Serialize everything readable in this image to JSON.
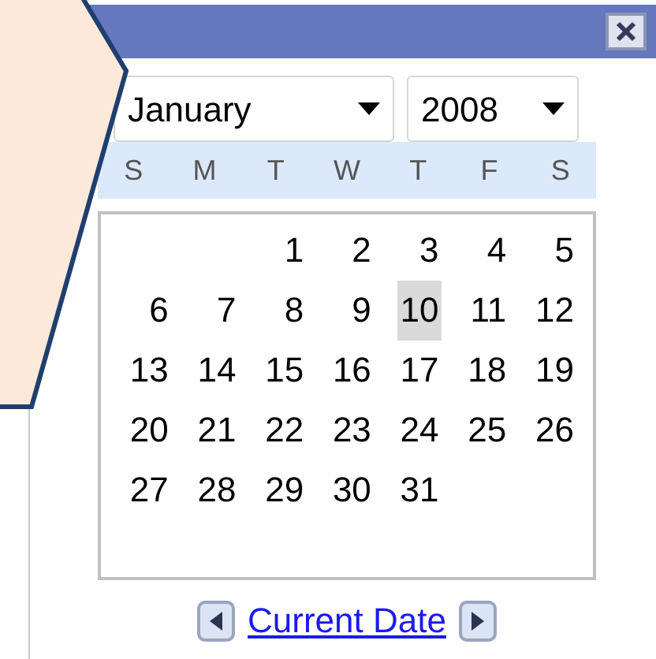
{
  "month": {
    "value": "January"
  },
  "year": {
    "value": "2008"
  },
  "weekdays": [
    "S",
    "M",
    "T",
    "W",
    "T",
    "F",
    "S"
  ],
  "weeks": [
    [
      {
        "kind": "empty"
      },
      {
        "kind": "empty"
      },
      {
        "kind": "day",
        "label": "1",
        "selected": false
      },
      {
        "kind": "day",
        "label": "2",
        "selected": false
      },
      {
        "kind": "day",
        "label": "3",
        "selected": false
      },
      {
        "kind": "day",
        "label": "4",
        "selected": false
      },
      {
        "kind": "day",
        "label": "5",
        "selected": false
      }
    ],
    [
      {
        "kind": "day",
        "label": "6",
        "selected": false
      },
      {
        "kind": "day",
        "label": "7",
        "selected": false
      },
      {
        "kind": "day",
        "label": "8",
        "selected": false
      },
      {
        "kind": "day",
        "label": "9",
        "selected": false
      },
      {
        "kind": "day",
        "label": "10",
        "selected": true
      },
      {
        "kind": "day",
        "label": "11",
        "selected": false
      },
      {
        "kind": "day",
        "label": "12",
        "selected": false
      }
    ],
    [
      {
        "kind": "day",
        "label": "13",
        "selected": false
      },
      {
        "kind": "day",
        "label": "14",
        "selected": false
      },
      {
        "kind": "day",
        "label": "15",
        "selected": false
      },
      {
        "kind": "day",
        "label": "16",
        "selected": false
      },
      {
        "kind": "day",
        "label": "17",
        "selected": false
      },
      {
        "kind": "day",
        "label": "18",
        "selected": false
      },
      {
        "kind": "day",
        "label": "19",
        "selected": false
      }
    ],
    [
      {
        "kind": "day",
        "label": "20",
        "selected": false
      },
      {
        "kind": "day",
        "label": "21",
        "selected": false
      },
      {
        "kind": "day",
        "label": "22",
        "selected": false
      },
      {
        "kind": "day",
        "label": "23",
        "selected": false
      },
      {
        "kind": "day",
        "label": "24",
        "selected": false
      },
      {
        "kind": "day",
        "label": "25",
        "selected": false
      },
      {
        "kind": "day",
        "label": "26",
        "selected": false
      }
    ],
    [
      {
        "kind": "day",
        "label": "27",
        "selected": false
      },
      {
        "kind": "day",
        "label": "28",
        "selected": false
      },
      {
        "kind": "day",
        "label": "29",
        "selected": false
      },
      {
        "kind": "day",
        "label": "30",
        "selected": false
      },
      {
        "kind": "day",
        "label": "31",
        "selected": false
      },
      {
        "kind": "empty"
      },
      {
        "kind": "empty"
      }
    ]
  ],
  "footer": {
    "link": "Current Date"
  }
}
